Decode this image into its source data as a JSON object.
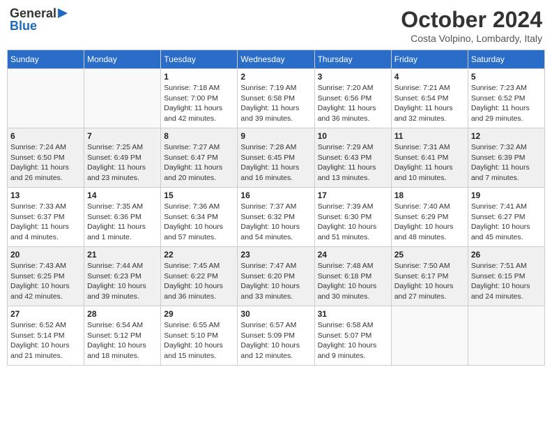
{
  "header": {
    "logo_general": "General",
    "logo_blue": "Blue",
    "month_title": "October 2024",
    "location": "Costa Volpino, Lombardy, Italy"
  },
  "weekdays": [
    "Sunday",
    "Monday",
    "Tuesday",
    "Wednesday",
    "Thursday",
    "Friday",
    "Saturday"
  ],
  "weeks": [
    [
      {
        "day": "",
        "content": ""
      },
      {
        "day": "",
        "content": ""
      },
      {
        "day": "1",
        "content": "Sunrise: 7:18 AM\nSunset: 7:00 PM\nDaylight: 11 hours and 42 minutes."
      },
      {
        "day": "2",
        "content": "Sunrise: 7:19 AM\nSunset: 6:58 PM\nDaylight: 11 hours and 39 minutes."
      },
      {
        "day": "3",
        "content": "Sunrise: 7:20 AM\nSunset: 6:56 PM\nDaylight: 11 hours and 36 minutes."
      },
      {
        "day": "4",
        "content": "Sunrise: 7:21 AM\nSunset: 6:54 PM\nDaylight: 11 hours and 32 minutes."
      },
      {
        "day": "5",
        "content": "Sunrise: 7:23 AM\nSunset: 6:52 PM\nDaylight: 11 hours and 29 minutes."
      }
    ],
    [
      {
        "day": "6",
        "content": "Sunrise: 7:24 AM\nSunset: 6:50 PM\nDaylight: 11 hours and 26 minutes."
      },
      {
        "day": "7",
        "content": "Sunrise: 7:25 AM\nSunset: 6:49 PM\nDaylight: 11 hours and 23 minutes."
      },
      {
        "day": "8",
        "content": "Sunrise: 7:27 AM\nSunset: 6:47 PM\nDaylight: 11 hours and 20 minutes."
      },
      {
        "day": "9",
        "content": "Sunrise: 7:28 AM\nSunset: 6:45 PM\nDaylight: 11 hours and 16 minutes."
      },
      {
        "day": "10",
        "content": "Sunrise: 7:29 AM\nSunset: 6:43 PM\nDaylight: 11 hours and 13 minutes."
      },
      {
        "day": "11",
        "content": "Sunrise: 7:31 AM\nSunset: 6:41 PM\nDaylight: 11 hours and 10 minutes."
      },
      {
        "day": "12",
        "content": "Sunrise: 7:32 AM\nSunset: 6:39 PM\nDaylight: 11 hours and 7 minutes."
      }
    ],
    [
      {
        "day": "13",
        "content": "Sunrise: 7:33 AM\nSunset: 6:37 PM\nDaylight: 11 hours and 4 minutes."
      },
      {
        "day": "14",
        "content": "Sunrise: 7:35 AM\nSunset: 6:36 PM\nDaylight: 11 hours and 1 minute."
      },
      {
        "day": "15",
        "content": "Sunrise: 7:36 AM\nSunset: 6:34 PM\nDaylight: 10 hours and 57 minutes."
      },
      {
        "day": "16",
        "content": "Sunrise: 7:37 AM\nSunset: 6:32 PM\nDaylight: 10 hours and 54 minutes."
      },
      {
        "day": "17",
        "content": "Sunrise: 7:39 AM\nSunset: 6:30 PM\nDaylight: 10 hours and 51 minutes."
      },
      {
        "day": "18",
        "content": "Sunrise: 7:40 AM\nSunset: 6:29 PM\nDaylight: 10 hours and 48 minutes."
      },
      {
        "day": "19",
        "content": "Sunrise: 7:41 AM\nSunset: 6:27 PM\nDaylight: 10 hours and 45 minutes."
      }
    ],
    [
      {
        "day": "20",
        "content": "Sunrise: 7:43 AM\nSunset: 6:25 PM\nDaylight: 10 hours and 42 minutes."
      },
      {
        "day": "21",
        "content": "Sunrise: 7:44 AM\nSunset: 6:23 PM\nDaylight: 10 hours and 39 minutes."
      },
      {
        "day": "22",
        "content": "Sunrise: 7:45 AM\nSunset: 6:22 PM\nDaylight: 10 hours and 36 minutes."
      },
      {
        "day": "23",
        "content": "Sunrise: 7:47 AM\nSunset: 6:20 PM\nDaylight: 10 hours and 33 minutes."
      },
      {
        "day": "24",
        "content": "Sunrise: 7:48 AM\nSunset: 6:18 PM\nDaylight: 10 hours and 30 minutes."
      },
      {
        "day": "25",
        "content": "Sunrise: 7:50 AM\nSunset: 6:17 PM\nDaylight: 10 hours and 27 minutes."
      },
      {
        "day": "26",
        "content": "Sunrise: 7:51 AM\nSunset: 6:15 PM\nDaylight: 10 hours and 24 minutes."
      }
    ],
    [
      {
        "day": "27",
        "content": "Sunrise: 6:52 AM\nSunset: 5:14 PM\nDaylight: 10 hours and 21 minutes."
      },
      {
        "day": "28",
        "content": "Sunrise: 6:54 AM\nSunset: 5:12 PM\nDaylight: 10 hours and 18 minutes."
      },
      {
        "day": "29",
        "content": "Sunrise: 6:55 AM\nSunset: 5:10 PM\nDaylight: 10 hours and 15 minutes."
      },
      {
        "day": "30",
        "content": "Sunrise: 6:57 AM\nSunset: 5:09 PM\nDaylight: 10 hours and 12 minutes."
      },
      {
        "day": "31",
        "content": "Sunrise: 6:58 AM\nSunset: 5:07 PM\nDaylight: 10 hours and 9 minutes."
      },
      {
        "day": "",
        "content": ""
      },
      {
        "day": "",
        "content": ""
      }
    ]
  ]
}
